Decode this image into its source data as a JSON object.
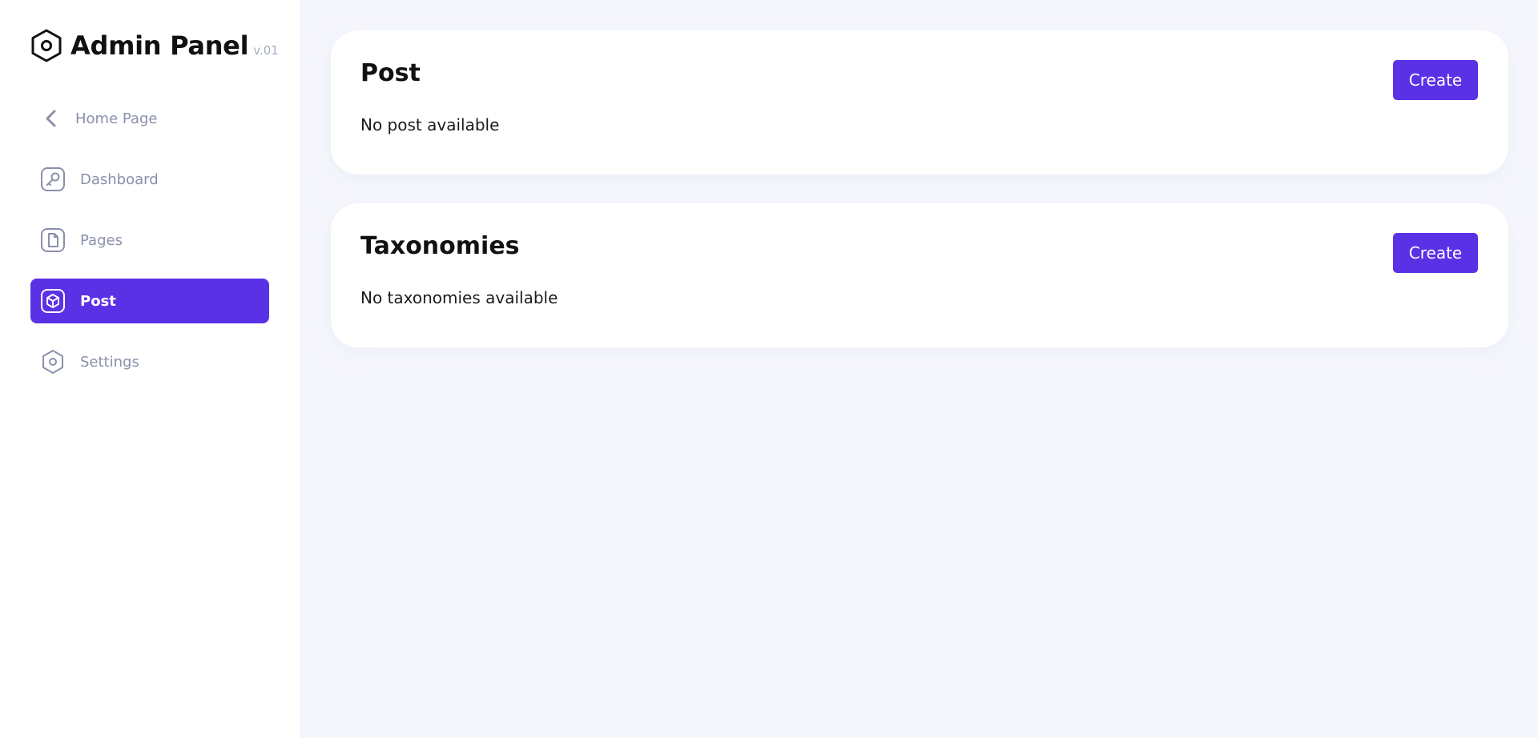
{
  "brand": {
    "title": "Admin Panel",
    "version": "v.01",
    "logo_icon": "hexagon-icon"
  },
  "sidebar": {
    "back": {
      "label": "Home Page",
      "icon": "chevron-left-icon"
    },
    "items": [
      {
        "label": "Dashboard",
        "icon": "key-icon",
        "active": false
      },
      {
        "label": "Pages",
        "icon": "document-icon",
        "active": false
      },
      {
        "label": "Post",
        "icon": "box-icon",
        "active": true
      },
      {
        "label": "Settings",
        "icon": "hexagon-settings-icon",
        "active": false
      }
    ]
  },
  "cards": [
    {
      "title": "Post",
      "create_label": "Create",
      "empty_text": "No post available"
    },
    {
      "title": "Taxonomies",
      "create_label": "Create",
      "empty_text": "No taxonomies available"
    }
  ],
  "colors": {
    "accent": "#5b31e6",
    "sidebar_text": "#8a90ab",
    "background": "#f6f7fd"
  }
}
